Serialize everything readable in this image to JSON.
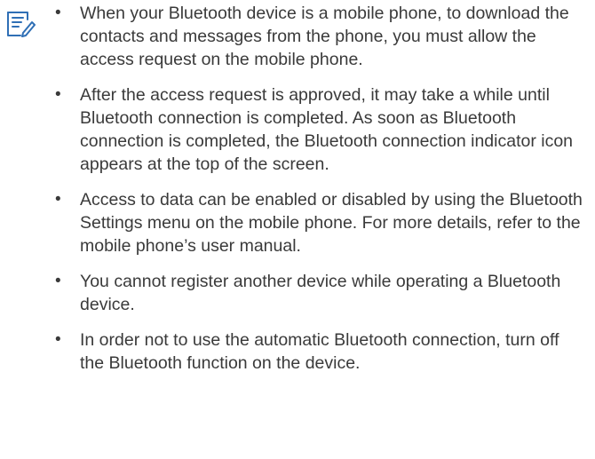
{
  "note": {
    "icon": "note-pencil-icon",
    "accent_color": "#2f6fb5",
    "items": [
      {
        "text": "When your Bluetooth device is a mobile phone, to download the contacts and messages from the phone, you must allow the access request on the mobile phone."
      },
      {
        "text": "After the access request is approved, it may take a while until Bluetooth connection is completed. As soon as Bluetooth connection is completed, the Bluetooth connection indicator icon appears at the top of the screen."
      },
      {
        "text": "Access to data can be enabled or disabled by using the Bluetooth Settings menu on the mobile phone. For more details, refer to the mobile phone’s user manual."
      },
      {
        "text": "You cannot register another device while operating a Bluetooth device."
      },
      {
        "text": "In order not to use the automatic Bluetooth connection, turn off the Bluetooth function on the device."
      }
    ]
  }
}
